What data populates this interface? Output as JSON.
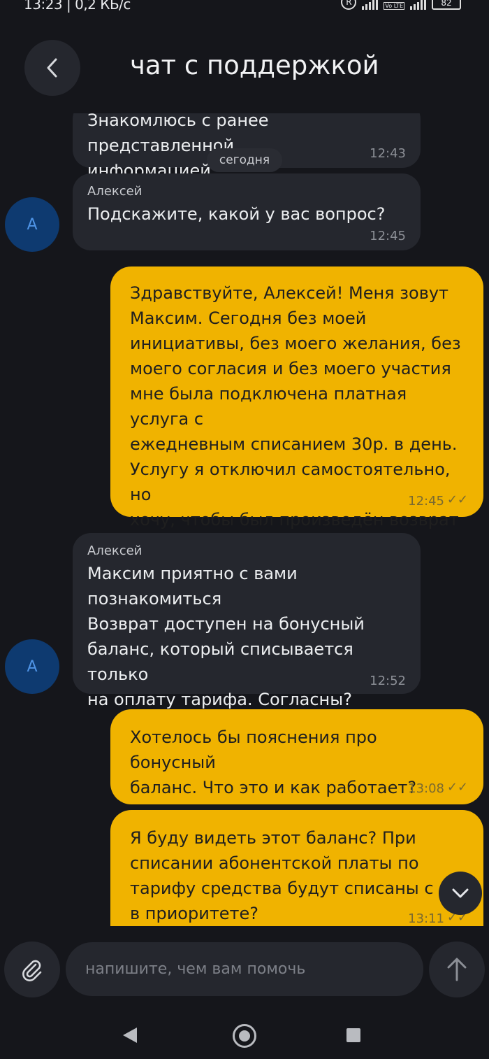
{
  "status_bar": {
    "time_speed": "13:23 | 0,2 КБ/с",
    "registered_mark": "R",
    "lte_label": "Vo LTE",
    "battery": "82"
  },
  "header": {
    "back_icon": "chevron-left-icon",
    "title": "чат с поддержкой"
  },
  "chat": {
    "date_divider": "сегодня",
    "messages": [
      {
        "direction": "in",
        "sender": "",
        "text": "Знакомлюсь с ранее\nпредставленной информацией",
        "time": "12:43"
      },
      {
        "direction": "in",
        "sender": "Алексей",
        "avatar": "А",
        "text": "Подскажите, какой у вас вопрос?",
        "time": "12:45"
      },
      {
        "direction": "out",
        "text": "Здравствуйте, Алексей! Меня зовут\nМаксим. Сегодня без моей\nинициативы, без моего желания, без\nмоего согласия и без моего участия\nмне была подключена платная услуга с\nежедневным списанием 30р. в день.\nУслугу я отключил самостоятельно, но\nхочу, чтобы был произведён возврат\nсписанных средств.",
        "time": "12:45",
        "status": "read"
      },
      {
        "direction": "in",
        "sender": "Алексей",
        "avatar": "А",
        "text": "Максим приятно с вами\nпознакомиться\nВозврат доступен на бонусный\nбаланс, который списывается только\nна оплату тарифа. Согласны?",
        "time": "12:52"
      },
      {
        "direction": "out",
        "text": "Хотелось бы пояснения про бонусный\nбаланс. Что это и как работает?",
        "time": "13:08",
        "status": "read"
      },
      {
        "direction": "out",
        "text": "Я буду видеть этот баланс? При\nсписании абонентской платы по\nтарифу средства будут списаны с н\nв приоритете?",
        "time": "13:11",
        "status": "read"
      }
    ],
    "read_ticks": "✓✓"
  },
  "composer": {
    "placeholder": "напишите, чем вам помочь",
    "attach_icon": "paperclip-icon",
    "send_icon": "arrow-up-icon",
    "scroll_icon": "chevron-down-icon"
  },
  "colors": {
    "background": "#15161b",
    "incoming_bubble": "#25272e",
    "outgoing_bubble": "#f0b300",
    "avatar": "#0e3a70"
  }
}
